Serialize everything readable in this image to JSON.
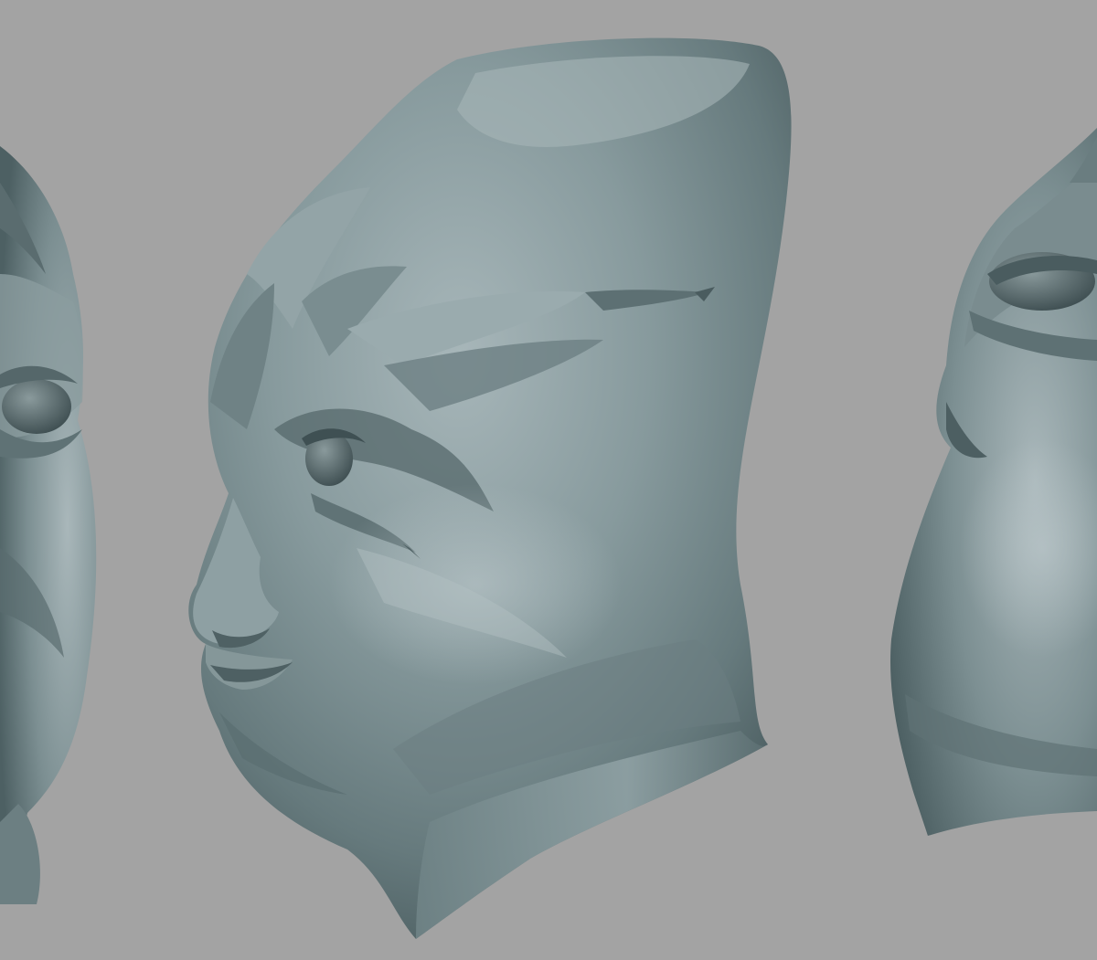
{
  "scene": {
    "description_free": true,
    "background_color": "#a3a3a3",
    "clay_base_color": "#7f9193",
    "clay_highlight_color": "#b7c4c8",
    "clay_shadow_color": "#45575a",
    "views": [
      {
        "id": "left",
        "label": ""
      },
      {
        "id": "center",
        "label": ""
      },
      {
        "id": "right",
        "label": ""
      }
    ]
  }
}
